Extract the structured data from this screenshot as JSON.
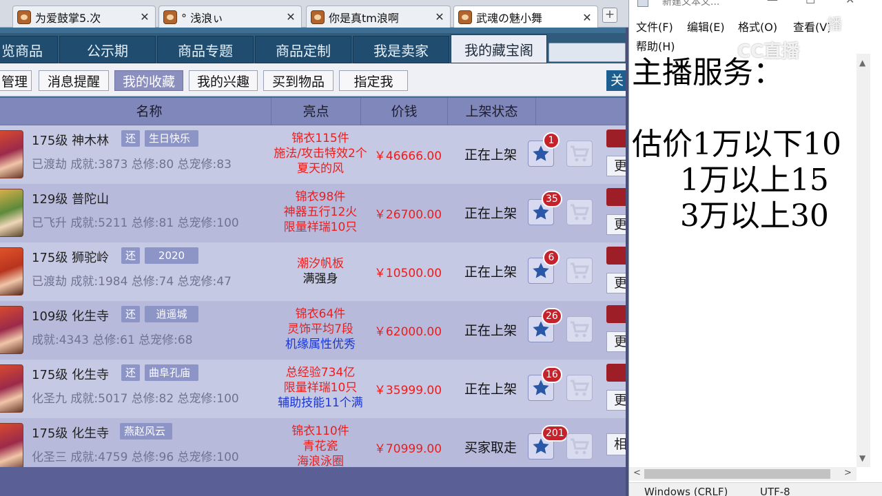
{
  "browser_tabs": [
    {
      "title": "为爱鼓掌5.次",
      "close": "✕"
    },
    {
      "title": "°  浅浪ぃ",
      "close": "✕"
    },
    {
      "title": "你是真tm浪啊",
      "close": "✕"
    },
    {
      "title": "武魂の魅小舞",
      "close": "✕"
    }
  ],
  "new_tab_label": "+",
  "game": {
    "nav_tabs": [
      "览商品",
      "公示期",
      "商品专题",
      "商品定制",
      "我是卖家",
      "我的藏宝阁"
    ],
    "sub_buttons": [
      "管理",
      "消息提醒",
      "我的收藏",
      "我的兴趣",
      "买到物品",
      "指定我"
    ],
    "sub_right_label": "关",
    "headers": {
      "name": "名称",
      "highlight": "亮点",
      "price": "价钱",
      "status": "上架状态"
    },
    "rows": [
      {
        "name": "175级  神木林",
        "tag1": "还",
        "tag2": "生日快乐",
        "info": "已渡劫  成就:3873  总修:80  总宠修:83",
        "highlights": [
          {
            "text": "锦衣115件",
            "color": "red"
          },
          {
            "text": "施法/攻击特效2个",
            "color": "red"
          },
          {
            "text": "夏天的风",
            "color": "red"
          }
        ],
        "price": "￥46666.00",
        "status": "正在上架",
        "fav_count": "1",
        "edge": "更"
      },
      {
        "name": "129级  普陀山",
        "tag1": "",
        "tag2": "",
        "info": "已飞升  成就:5211  总修:81  总宠修:100",
        "highlights": [
          {
            "text": "锦衣98件",
            "color": "red"
          },
          {
            "text": "神器五行12火",
            "color": "red"
          },
          {
            "text": "限量祥瑞10只",
            "color": "red"
          }
        ],
        "price": "￥26700.00",
        "status": "正在上架",
        "fav_count": "35",
        "edge": "更"
      },
      {
        "name": "175级  狮驼岭",
        "tag1": "还",
        "tag2": "2020",
        "info": "已渡劫  成就:1984  总修:74  总宠修:47",
        "highlights": [
          {
            "text": "潮汐帆板",
            "color": "red"
          },
          {
            "text": "满强身",
            "color": "black"
          }
        ],
        "price": "￥10500.00",
        "status": "正在上架",
        "fav_count": "6",
        "edge": "更"
      },
      {
        "name": "109级  化生寺",
        "tag1": "还",
        "tag2": "逍遥城",
        "info": "成就:4343  总修:61  总宠修:68",
        "highlights": [
          {
            "text": "锦衣64件",
            "color": "red"
          },
          {
            "text": "灵饰平均7段",
            "color": "red"
          },
          {
            "text": "机缘属性优秀",
            "color": "blue"
          }
        ],
        "price": "￥62000.00",
        "status": "正在上架",
        "fav_count": "26",
        "edge": "更"
      },
      {
        "name": "175级  化生寺",
        "tag1": "还",
        "tag2": "曲阜孔庙",
        "info": "化圣九  成就:5017  总修:82  总宠修:100",
        "highlights": [
          {
            "text": "总经验734亿",
            "color": "red"
          },
          {
            "text": "限量祥瑞10只",
            "color": "red"
          },
          {
            "text": "辅助技能11个满",
            "color": "blue"
          }
        ],
        "price": "￥35999.00",
        "status": "正在上架",
        "fav_count": "16",
        "edge": "更"
      },
      {
        "name": "175级  化生寺",
        "tag1": "",
        "tag2": "燕赵风云",
        "info": "化圣三  成就:4759  总修:96  总宠修:100",
        "highlights": [
          {
            "text": "锦衣110件",
            "color": "red"
          },
          {
            "text": "青花瓷",
            "color": "red"
          },
          {
            "text": "海浪泳圈",
            "color": "red"
          }
        ],
        "price": "￥70999.00",
        "status": "买家取走",
        "fav_count": "201",
        "edge": "相"
      }
    ]
  },
  "notepad": {
    "title": "新建文本文...",
    "menu": [
      "文件(F)",
      "编辑(E)",
      "格式(O)",
      "查看(V)",
      "帮助(H)"
    ],
    "content": "主播服务：\n\n估价1万以下10\n     1万以上15\n     3万以上30",
    "status_encoding": "Windows (CRLF)",
    "status_charset": "UTF-8"
  },
  "watermark": {
    "brand": "CC直播",
    "corner": "播"
  }
}
